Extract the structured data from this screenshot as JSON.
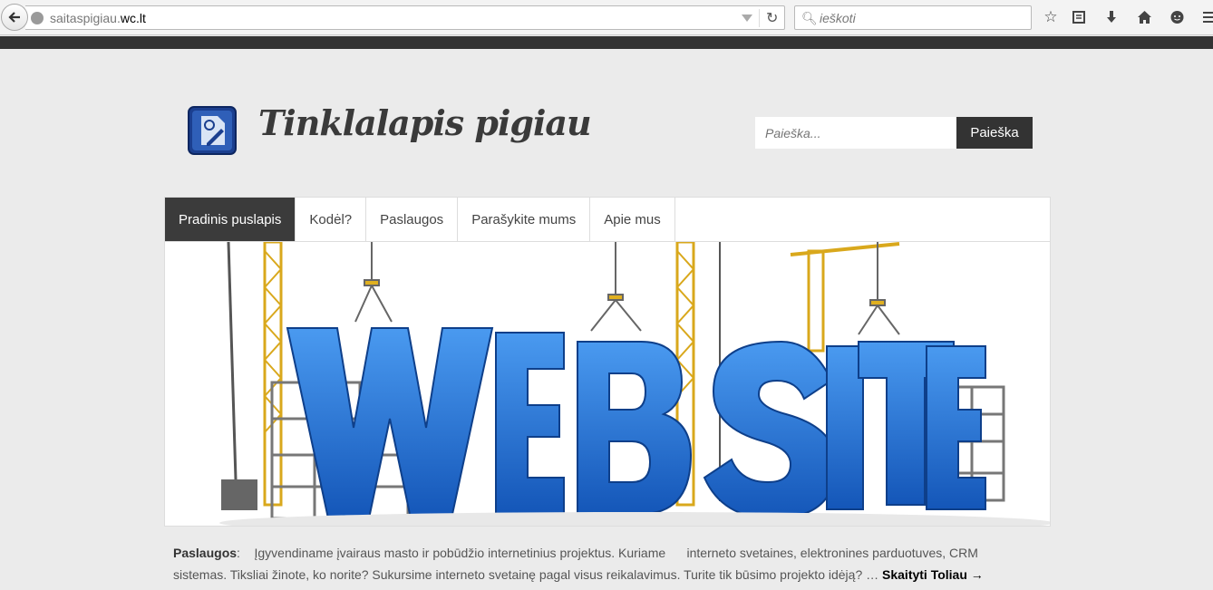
{
  "browser": {
    "url_prefix": "saitaspigiau.",
    "url_domain": "wc.lt",
    "search_placeholder": "ieškoti"
  },
  "header": {
    "site_title": "Tinklalapis pigiau",
    "search_placeholder": "Paieška...",
    "search_button": "Paieška"
  },
  "nav": {
    "items": [
      {
        "label": "Pradinis puslapis",
        "active": true
      },
      {
        "label": "Kodėl?"
      },
      {
        "label": "Paslaugos"
      },
      {
        "label": "Parašykite mums"
      },
      {
        "label": "Apie mus"
      }
    ]
  },
  "banner": {
    "word": "WEBSITE"
  },
  "excerpt": {
    "label": "Paslaugos",
    "text": "Įgyvendiname įvairaus masto ir pobūdžio internetinius projektus. Kuriame      interneto svetaines, elektronines parduotuves, CRM sistemas. Tiksliai žinote, ko norite? Sukursime interneto svetainę pagal visus reikalavimus. Turite tik būsimo projekto idėją? …",
    "read_more": "Skaityti Toliau →"
  },
  "colors": {
    "accent_dark": "#333333",
    "banner_blue": "#1f6fd1"
  }
}
